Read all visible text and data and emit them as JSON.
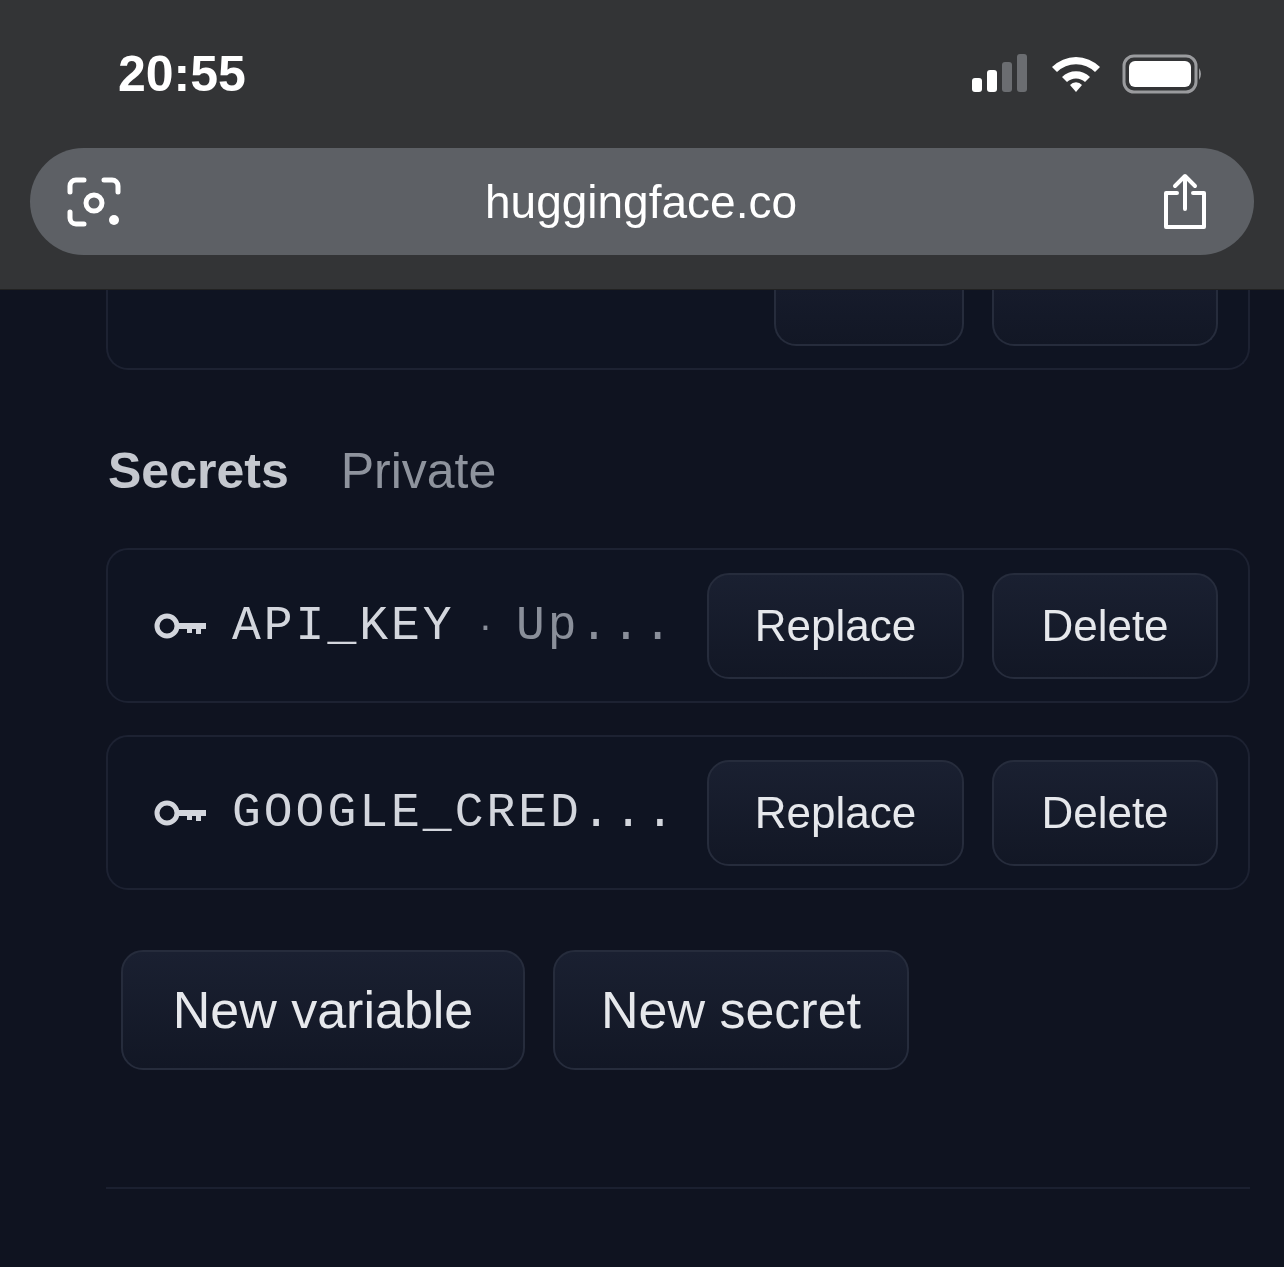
{
  "status_bar": {
    "time": "20:55"
  },
  "browser": {
    "url": "huggingface.co"
  },
  "secrets_section": {
    "title": "Secrets",
    "subtitle": "Private"
  },
  "secrets": [
    {
      "name": "API_KEY",
      "separator": "·",
      "meta": "Up...",
      "buttons": [
        "Replace",
        "Delete"
      ]
    },
    {
      "name": "GOOGLE_CRED...",
      "buttons": [
        "Replace",
        "Delete"
      ]
    }
  ],
  "actions": [
    "New variable",
    "New secret"
  ]
}
